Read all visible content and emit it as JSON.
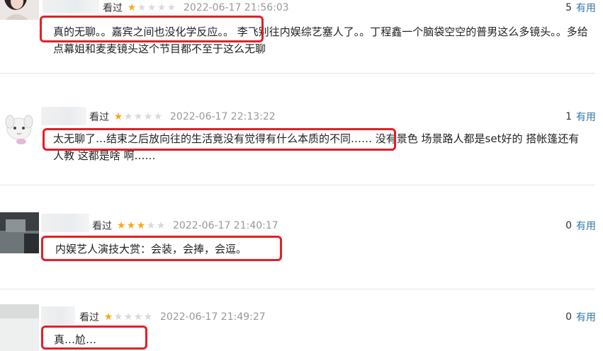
{
  "comments": [
    {
      "status": "看过",
      "rating": 1,
      "date": "2022-06-17 21:56:03",
      "votes": "5",
      "useful_label": "有用",
      "text": "真的无聊。。嘉宾之间也没化学反应。。 李飞别往内娱综艺塞人了。。丁程鑫一个脑袋空空的普男这么多镜头。。多给点幕姐和麦麦镜头这个节目都不至于这么无聊"
    },
    {
      "status": "看过",
      "rating": 1,
      "date": "2022-06-17 22:13:22",
      "votes": "1",
      "useful_label": "有用",
      "text": "太无聊了…结束之后放向往的生活竟没有觉得有什么本质的不同…… 没有景色 场景路人都是set好的 搭帐篷还有人教 这都是啥 啊……"
    },
    {
      "status": "看过",
      "rating": 3,
      "date": "2022-06-17 21:40:17",
      "votes": "0",
      "useful_label": "有用",
      "text": "内娱艺人演技大赏：会装，会捧，会逗。"
    },
    {
      "status": "看过",
      "rating": 1,
      "date": "2022-06-17 21:49:27",
      "votes": "0",
      "useful_label": "有用",
      "text": "真…尬…"
    }
  ],
  "star_colors": {
    "on": "#f7a81b",
    "off": "#d9d9d9"
  },
  "highlight_color": "#e31f26",
  "link_color": "#3377aa"
}
